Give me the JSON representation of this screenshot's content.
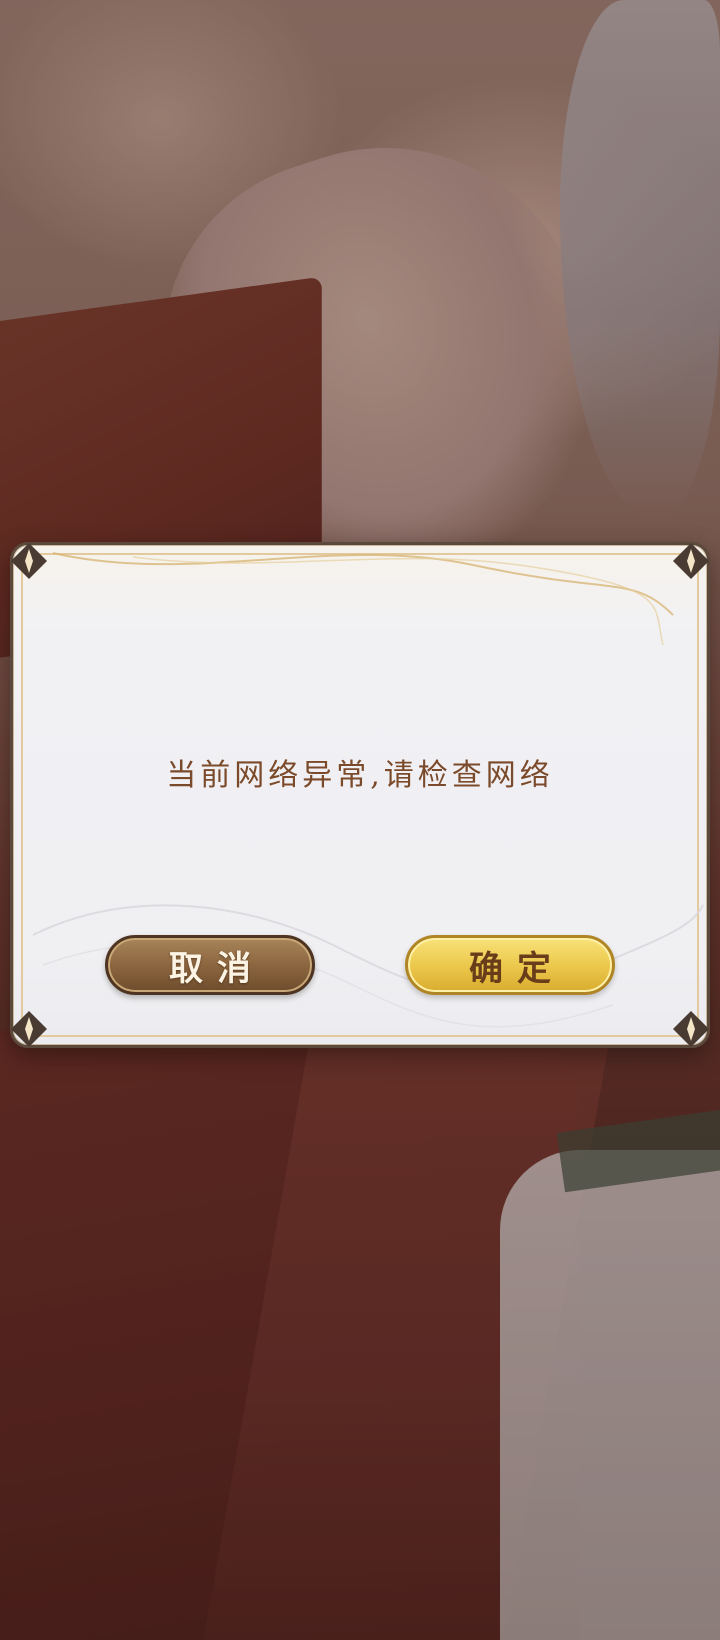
{
  "dialog": {
    "message": "当前网络异常,请检查网络",
    "cancel_label": "取消",
    "confirm_label": "确定"
  },
  "colors": {
    "message_text": "#7b4a2a",
    "cancel_button": "#8c6640",
    "confirm_button": "#ecc94d",
    "frame_gold": "#e3c99e"
  },
  "icons": {
    "corner": "ornament-corner-icon"
  }
}
